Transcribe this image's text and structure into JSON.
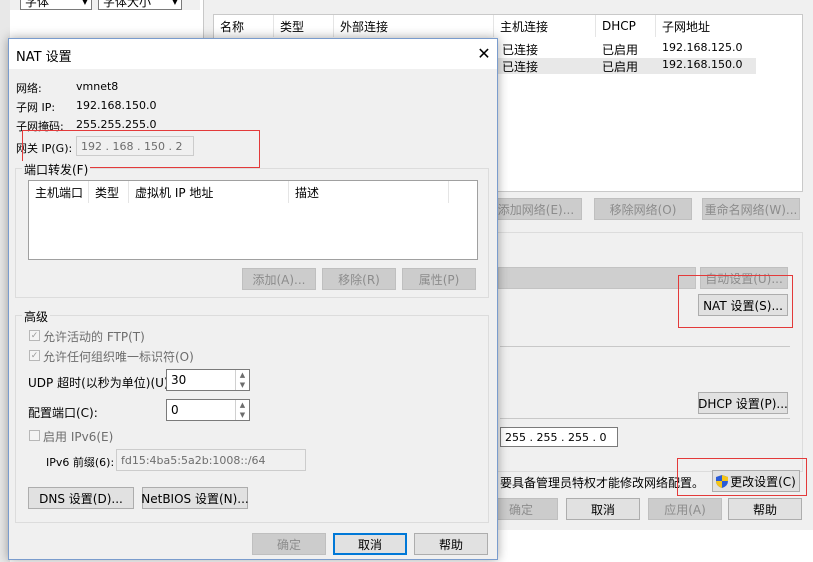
{
  "topbar": {
    "font_select": "字体",
    "size_select": "字体大小"
  },
  "bg": {
    "table_headers": [
      "名称",
      "类型",
      "外部连接",
      "主机连接",
      "DHCP",
      "子网地址"
    ],
    "rows": [
      {
        "host": "已连接",
        "dhcp": "已启用",
        "subnet": "192.168.125.0"
      },
      {
        "host": "已连接",
        "dhcp": "已启用",
        "subnet": "192.168.150.0"
      }
    ],
    "add_network": "添加网络(E)...",
    "remove_network": "移除网络(O)",
    "rename_network": "重命名网络(W)...",
    "auto_settings": "自动设置(U)...",
    "nat_settings": "NAT 设置(S)...",
    "dhcp_settings": "DHCP 设置(P)...",
    "mask_field": "255 . 255 . 255 . 0",
    "admin_note": "要具备管理员特权才能修改网络配置。",
    "change_settings": "更改设置(C)",
    "ok": "确定",
    "cancel": "取消",
    "apply": "应用(A)",
    "help": "帮助"
  },
  "dialog": {
    "title": "NAT 设置",
    "network_label": "网络:",
    "network_value": "vmnet8",
    "subnet_ip_label": "子网 IP:",
    "subnet_ip_value": "192.168.150.0",
    "subnet_mask_label": "子网掩码:",
    "subnet_mask_value": "255.255.255.0",
    "gateway_label": "网关 IP(G):",
    "gateway_value": "192 . 168 . 150 .  2",
    "port_forward_label": "端口转发(F)",
    "port_headers": [
      "主机端口",
      "类型",
      "虚拟机 IP 地址",
      "描述"
    ],
    "add": "添加(A)...",
    "remove": "移除(R)",
    "properties": "属性(P)",
    "advanced_label": "高级",
    "allow_ftp": "允许活动的 FTP(T)",
    "allow_org": "允许任何组织唯一标识符(O)",
    "udp_label": "UDP 超时(以秒为单位)(U):",
    "udp_value": "30",
    "config_port_label": "配置端口(C):",
    "config_port_value": "0",
    "enable_ipv6": "启用 IPv6(E)",
    "ipv6_prefix_label": "IPv6 前缀(6):",
    "ipv6_prefix_value": "fd15:4ba5:5a2b:1008::/64",
    "dns_settings": "DNS 设置(D)...",
    "netbios_settings": "NetBIOS 设置(N)...",
    "ok": "确定",
    "cancel": "取消",
    "help": "帮助"
  }
}
